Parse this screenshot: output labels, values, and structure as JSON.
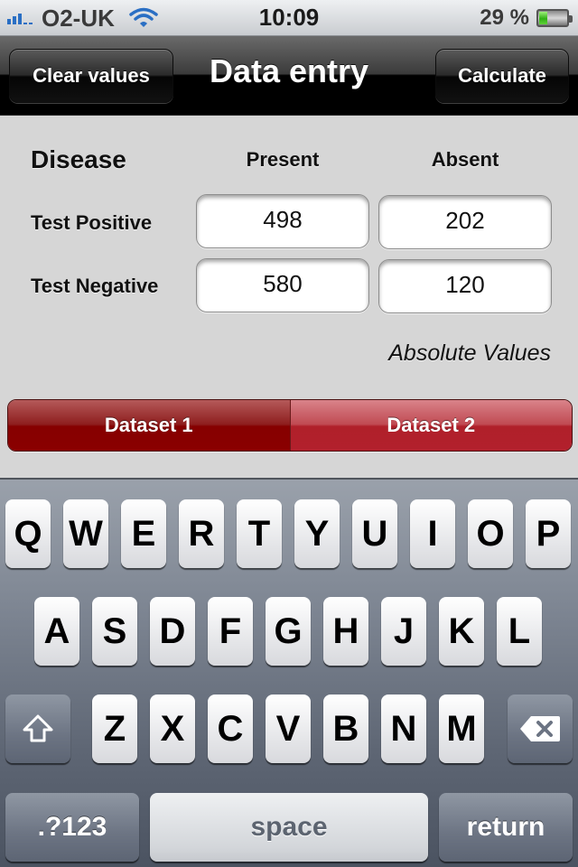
{
  "status_bar": {
    "carrier": "O2-UK",
    "time": "10:09",
    "battery_percent_label": "29 %",
    "battery_level": 0.29,
    "signal_bars_filled": 3,
    "signal_bars_total": 5,
    "icons": [
      "signal-icon",
      "wifi-icon",
      "battery-icon"
    ]
  },
  "nav": {
    "title": "Data entry",
    "left_button": "Clear values",
    "right_button": "Calculate"
  },
  "table": {
    "row_header": "Disease",
    "columns": [
      "Present",
      "Absent"
    ],
    "rows": [
      {
        "label": "Test Positive",
        "present": "498",
        "absent": "202"
      },
      {
        "label": "Test Negative",
        "present": "580",
        "absent": "120"
      }
    ],
    "mode_label": "Absolute Values"
  },
  "segmented": {
    "options": [
      "Dataset 1",
      "Dataset 2"
    ],
    "selected_index": 0
  },
  "keyboard": {
    "row1": [
      "Q",
      "W",
      "E",
      "R",
      "T",
      "Y",
      "U",
      "I",
      "O",
      "P"
    ],
    "row2": [
      "A",
      "S",
      "D",
      "F",
      "G",
      "H",
      "J",
      "K",
      "L"
    ],
    "row3": [
      "Z",
      "X",
      "C",
      "V",
      "B",
      "N",
      "M"
    ],
    "numbers_key": ".?123",
    "space_key": "space",
    "return_key": "return",
    "shift_icon": "shift-icon",
    "delete_icon": "backspace-icon"
  },
  "colors": {
    "segment_selected": "#860000",
    "segment_unselected": "#b0202a",
    "signal_blue": "#2a6fc4",
    "battery_green": "#30b014"
  }
}
